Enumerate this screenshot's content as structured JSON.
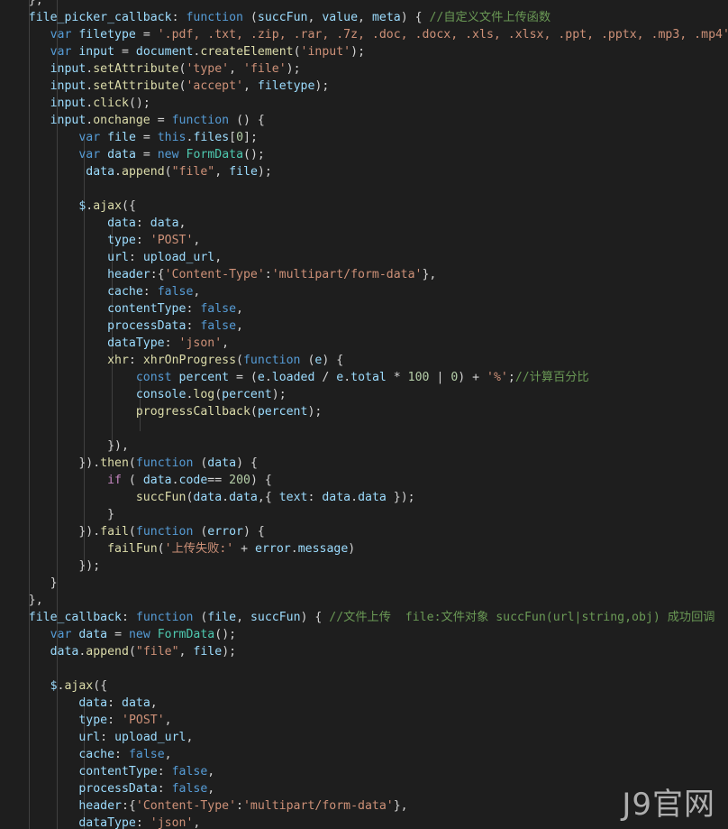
{
  "colors": {
    "background": "#1e1e1e",
    "keyword": "#569cd6",
    "control": "#c586c0",
    "property": "#9cdcfe",
    "function": "#dcdcaa",
    "string": "#ce9178",
    "comment": "#6a9955",
    "number": "#b5cea8",
    "class": "#4ec9b0",
    "plain": "#d4d4d4"
  },
  "watermark": "J9官网",
  "lines": [
    [
      [
        "plain",
        "    },"
      ]
    ],
    [
      [
        "plain",
        "    "
      ],
      [
        "property",
        "file_picker_callback"
      ],
      [
        "plain",
        ": "
      ],
      [
        "keyword",
        "function"
      ],
      [
        "plain",
        " ("
      ],
      [
        "variable",
        "succFun"
      ],
      [
        "plain",
        ", "
      ],
      [
        "variable",
        "value"
      ],
      [
        "plain",
        ", "
      ],
      [
        "variable",
        "meta"
      ],
      [
        "plain",
        ") { "
      ],
      [
        "comment",
        "//自定义文件上传函数"
      ]
    ],
    [
      [
        "plain",
        "       "
      ],
      [
        "keyword",
        "var"
      ],
      [
        "plain",
        " "
      ],
      [
        "variable",
        "filetype"
      ],
      [
        "plain",
        " = "
      ],
      [
        "string",
        "'.pdf, .txt, .zip, .rar, .7z, .doc, .docx, .xls, .xlsx, .ppt, .pptx, .mp3, .mp4'"
      ]
    ],
    [
      [
        "plain",
        "       "
      ],
      [
        "keyword",
        "var"
      ],
      [
        "plain",
        " "
      ],
      [
        "variable",
        "input"
      ],
      [
        "plain",
        " = "
      ],
      [
        "variable",
        "document"
      ],
      [
        "plain",
        "."
      ],
      [
        "function",
        "createElement"
      ],
      [
        "plain",
        "("
      ],
      [
        "string",
        "'input'"
      ],
      [
        "plain",
        ");"
      ]
    ],
    [
      [
        "plain",
        "       "
      ],
      [
        "variable",
        "input"
      ],
      [
        "plain",
        "."
      ],
      [
        "function",
        "setAttribute"
      ],
      [
        "plain",
        "("
      ],
      [
        "string",
        "'type'"
      ],
      [
        "plain",
        ", "
      ],
      [
        "string",
        "'file'"
      ],
      [
        "plain",
        ");"
      ]
    ],
    [
      [
        "plain",
        "       "
      ],
      [
        "variable",
        "input"
      ],
      [
        "plain",
        "."
      ],
      [
        "function",
        "setAttribute"
      ],
      [
        "plain",
        "("
      ],
      [
        "string",
        "'accept'"
      ],
      [
        "plain",
        ", "
      ],
      [
        "variable",
        "filetype"
      ],
      [
        "plain",
        ");"
      ]
    ],
    [
      [
        "plain",
        "       "
      ],
      [
        "variable",
        "input"
      ],
      [
        "plain",
        "."
      ],
      [
        "function",
        "click"
      ],
      [
        "plain",
        "();"
      ]
    ],
    [
      [
        "plain",
        "       "
      ],
      [
        "variable",
        "input"
      ],
      [
        "plain",
        "."
      ],
      [
        "function",
        "onchange"
      ],
      [
        "plain",
        " = "
      ],
      [
        "keyword",
        "function"
      ],
      [
        "plain",
        " () {"
      ]
    ],
    [
      [
        "plain",
        "           "
      ],
      [
        "keyword",
        "var"
      ],
      [
        "plain",
        " "
      ],
      [
        "variable",
        "file"
      ],
      [
        "plain",
        " = "
      ],
      [
        "keyword",
        "this"
      ],
      [
        "plain",
        "."
      ],
      [
        "variable",
        "files"
      ],
      [
        "plain",
        "["
      ],
      [
        "number",
        "0"
      ],
      [
        "plain",
        "];"
      ]
    ],
    [
      [
        "plain",
        "           "
      ],
      [
        "keyword",
        "var"
      ],
      [
        "plain",
        " "
      ],
      [
        "variable",
        "data"
      ],
      [
        "plain",
        " = "
      ],
      [
        "keyword",
        "new"
      ],
      [
        "plain",
        " "
      ],
      [
        "class",
        "FormData"
      ],
      [
        "plain",
        "();"
      ]
    ],
    [
      [
        "plain",
        "            "
      ],
      [
        "variable",
        "data"
      ],
      [
        "plain",
        "."
      ],
      [
        "function",
        "append"
      ],
      [
        "plain",
        "("
      ],
      [
        "string",
        "\"file\""
      ],
      [
        "plain",
        ", "
      ],
      [
        "variable",
        "file"
      ],
      [
        "plain",
        ");"
      ]
    ],
    [
      [
        "plain",
        ""
      ]
    ],
    [
      [
        "plain",
        "           "
      ],
      [
        "variable",
        "$"
      ],
      [
        "plain",
        "."
      ],
      [
        "function",
        "ajax"
      ],
      [
        "plain",
        "({"
      ]
    ],
    [
      [
        "plain",
        "               "
      ],
      [
        "property",
        "data"
      ],
      [
        "plain",
        ": "
      ],
      [
        "variable",
        "data"
      ],
      [
        "plain",
        ","
      ]
    ],
    [
      [
        "plain",
        "               "
      ],
      [
        "property",
        "type"
      ],
      [
        "plain",
        ": "
      ],
      [
        "string",
        "'POST'"
      ],
      [
        "plain",
        ","
      ]
    ],
    [
      [
        "plain",
        "               "
      ],
      [
        "property",
        "url"
      ],
      [
        "plain",
        ": "
      ],
      [
        "variable",
        "upload_url"
      ],
      [
        "plain",
        ","
      ]
    ],
    [
      [
        "plain",
        "               "
      ],
      [
        "property",
        "header"
      ],
      [
        "plain",
        ":{"
      ],
      [
        "string",
        "'Content-Type'"
      ],
      [
        "plain",
        ":"
      ],
      [
        "string",
        "'multipart/form-data'"
      ],
      [
        "plain",
        "},"
      ]
    ],
    [
      [
        "plain",
        "               "
      ],
      [
        "property",
        "cache"
      ],
      [
        "plain",
        ": "
      ],
      [
        "keyword",
        "false"
      ],
      [
        "plain",
        ","
      ]
    ],
    [
      [
        "plain",
        "               "
      ],
      [
        "property",
        "contentType"
      ],
      [
        "plain",
        ": "
      ],
      [
        "keyword",
        "false"
      ],
      [
        "plain",
        ","
      ]
    ],
    [
      [
        "plain",
        "               "
      ],
      [
        "property",
        "processData"
      ],
      [
        "plain",
        ": "
      ],
      [
        "keyword",
        "false"
      ],
      [
        "plain",
        ","
      ]
    ],
    [
      [
        "plain",
        "               "
      ],
      [
        "property",
        "dataType"
      ],
      [
        "plain",
        ": "
      ],
      [
        "string",
        "'json'"
      ],
      [
        "plain",
        ","
      ]
    ],
    [
      [
        "plain",
        "               "
      ],
      [
        "function",
        "xhr"
      ],
      [
        "plain",
        ": "
      ],
      [
        "function",
        "xhrOnProgress"
      ],
      [
        "plain",
        "("
      ],
      [
        "keyword",
        "function"
      ],
      [
        "plain",
        " ("
      ],
      [
        "variable",
        "e"
      ],
      [
        "plain",
        ") {"
      ]
    ],
    [
      [
        "plain",
        "                   "
      ],
      [
        "keyword",
        "const"
      ],
      [
        "plain",
        " "
      ],
      [
        "variable",
        "percent"
      ],
      [
        "plain",
        " = ("
      ],
      [
        "variable",
        "e"
      ],
      [
        "plain",
        "."
      ],
      [
        "variable",
        "loaded"
      ],
      [
        "plain",
        " / "
      ],
      [
        "variable",
        "e"
      ],
      [
        "plain",
        "."
      ],
      [
        "variable",
        "total"
      ],
      [
        "plain",
        " * "
      ],
      [
        "number",
        "100"
      ],
      [
        "plain",
        " | "
      ],
      [
        "number",
        "0"
      ],
      [
        "plain",
        ") + "
      ],
      [
        "string",
        "'%'"
      ],
      [
        "plain",
        ";"
      ],
      [
        "comment",
        "//计算百分比"
      ]
    ],
    [
      [
        "plain",
        "                   "
      ],
      [
        "variable",
        "console"
      ],
      [
        "plain",
        "."
      ],
      [
        "function",
        "log"
      ],
      [
        "plain",
        "("
      ],
      [
        "variable",
        "percent"
      ],
      [
        "plain",
        ");"
      ]
    ],
    [
      [
        "plain",
        "                   "
      ],
      [
        "function",
        "progressCallback"
      ],
      [
        "plain",
        "("
      ],
      [
        "variable",
        "percent"
      ],
      [
        "plain",
        ");"
      ]
    ],
    [
      [
        "plain",
        ""
      ]
    ],
    [
      [
        "plain",
        "               }),"
      ]
    ],
    [
      [
        "plain",
        "           })."
      ],
      [
        "function",
        "then"
      ],
      [
        "plain",
        "("
      ],
      [
        "keyword",
        "function"
      ],
      [
        "plain",
        " ("
      ],
      [
        "variable",
        "data"
      ],
      [
        "plain",
        ") {"
      ]
    ],
    [
      [
        "plain",
        "               "
      ],
      [
        "control",
        "if"
      ],
      [
        "plain",
        " ( "
      ],
      [
        "variable",
        "data"
      ],
      [
        "plain",
        "."
      ],
      [
        "variable",
        "code"
      ],
      [
        "plain",
        "== "
      ],
      [
        "number",
        "200"
      ],
      [
        "plain",
        ") {"
      ]
    ],
    [
      [
        "plain",
        "                   "
      ],
      [
        "function",
        "succFun"
      ],
      [
        "plain",
        "("
      ],
      [
        "variable",
        "data"
      ],
      [
        "plain",
        "."
      ],
      [
        "variable",
        "data"
      ],
      [
        "plain",
        ",{ "
      ],
      [
        "property",
        "text"
      ],
      [
        "plain",
        ": "
      ],
      [
        "variable",
        "data"
      ],
      [
        "plain",
        "."
      ],
      [
        "variable",
        "data"
      ],
      [
        "plain",
        " });"
      ]
    ],
    [
      [
        "plain",
        "               }"
      ]
    ],
    [
      [
        "plain",
        "           })."
      ],
      [
        "function",
        "fail"
      ],
      [
        "plain",
        "("
      ],
      [
        "keyword",
        "function"
      ],
      [
        "plain",
        " ("
      ],
      [
        "variable",
        "error"
      ],
      [
        "plain",
        ") {"
      ]
    ],
    [
      [
        "plain",
        "               "
      ],
      [
        "function",
        "failFun"
      ],
      [
        "plain",
        "("
      ],
      [
        "string",
        "'上传失败:'"
      ],
      [
        "plain",
        " + "
      ],
      [
        "variable",
        "error"
      ],
      [
        "plain",
        "."
      ],
      [
        "variable",
        "message"
      ],
      [
        "plain",
        ")"
      ]
    ],
    [
      [
        "plain",
        "           });"
      ]
    ],
    [
      [
        "plain",
        "       }"
      ]
    ],
    [
      [
        "plain",
        "    },"
      ]
    ],
    [
      [
        "plain",
        "    "
      ],
      [
        "property",
        "file_callback"
      ],
      [
        "plain",
        ": "
      ],
      [
        "keyword",
        "function"
      ],
      [
        "plain",
        " ("
      ],
      [
        "variable",
        "file"
      ],
      [
        "plain",
        ", "
      ],
      [
        "variable",
        "succFun"
      ],
      [
        "plain",
        ") { "
      ],
      [
        "comment",
        "//文件上传  file:文件对象 succFun(url|string,obj) 成功回调"
      ]
    ],
    [
      [
        "plain",
        "       "
      ],
      [
        "keyword",
        "var"
      ],
      [
        "plain",
        " "
      ],
      [
        "variable",
        "data"
      ],
      [
        "plain",
        " = "
      ],
      [
        "keyword",
        "new"
      ],
      [
        "plain",
        " "
      ],
      [
        "class",
        "FormData"
      ],
      [
        "plain",
        "();"
      ]
    ],
    [
      [
        "plain",
        "       "
      ],
      [
        "variable",
        "data"
      ],
      [
        "plain",
        "."
      ],
      [
        "function",
        "append"
      ],
      [
        "plain",
        "("
      ],
      [
        "string",
        "\"file\""
      ],
      [
        "plain",
        ", "
      ],
      [
        "variable",
        "file"
      ],
      [
        "plain",
        ");"
      ]
    ],
    [
      [
        "plain",
        ""
      ]
    ],
    [
      [
        "plain",
        "       "
      ],
      [
        "variable",
        "$"
      ],
      [
        "plain",
        "."
      ],
      [
        "function",
        "ajax"
      ],
      [
        "plain",
        "({"
      ]
    ],
    [
      [
        "plain",
        "           "
      ],
      [
        "property",
        "data"
      ],
      [
        "plain",
        ": "
      ],
      [
        "variable",
        "data"
      ],
      [
        "plain",
        ","
      ]
    ],
    [
      [
        "plain",
        "           "
      ],
      [
        "property",
        "type"
      ],
      [
        "plain",
        ": "
      ],
      [
        "string",
        "'POST'"
      ],
      [
        "plain",
        ","
      ]
    ],
    [
      [
        "plain",
        "           "
      ],
      [
        "property",
        "url"
      ],
      [
        "plain",
        ": "
      ],
      [
        "variable",
        "upload_url"
      ],
      [
        "plain",
        ","
      ]
    ],
    [
      [
        "plain",
        "           "
      ],
      [
        "property",
        "cache"
      ],
      [
        "plain",
        ": "
      ],
      [
        "keyword",
        "false"
      ],
      [
        "plain",
        ","
      ]
    ],
    [
      [
        "plain",
        "           "
      ],
      [
        "property",
        "contentType"
      ],
      [
        "plain",
        ": "
      ],
      [
        "keyword",
        "false"
      ],
      [
        "plain",
        ","
      ]
    ],
    [
      [
        "plain",
        "           "
      ],
      [
        "property",
        "processData"
      ],
      [
        "plain",
        ": "
      ],
      [
        "keyword",
        "false"
      ],
      [
        "plain",
        ","
      ]
    ],
    [
      [
        "plain",
        "           "
      ],
      [
        "property",
        "header"
      ],
      [
        "plain",
        ":{"
      ],
      [
        "string",
        "'Content-Type'"
      ],
      [
        "plain",
        ":"
      ],
      [
        "string",
        "'multipart/form-data'"
      ],
      [
        "plain",
        "},"
      ]
    ],
    [
      [
        "plain",
        "           "
      ],
      [
        "property",
        "dataType"
      ],
      [
        "plain",
        ": "
      ],
      [
        "string",
        "'json'"
      ],
      [
        "plain",
        ","
      ]
    ]
  ]
}
